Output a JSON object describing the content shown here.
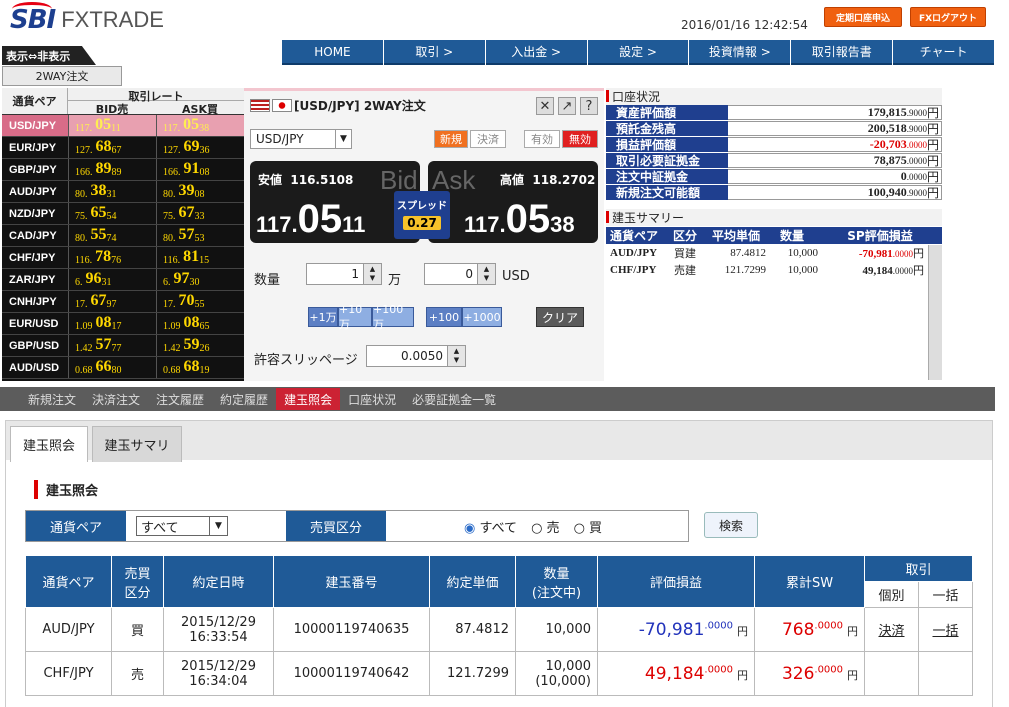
{
  "header": {
    "logo_main": "SBI",
    "logo_sub": "FXTRADE",
    "datetime": "2016/01/16 12:42:54",
    "btn_periodic": "定期口座申込",
    "btn_logout": "FXログアウト"
  },
  "nav": [
    "HOME",
    "取引 >",
    "入出金 >",
    "設定 >",
    "投資情報 >",
    "取引報告書",
    "チャート"
  ],
  "toggle_label": "表示⇔非表示",
  "way_tab": "2WAY注文",
  "rates": {
    "hdr_pair": "通貨ペア",
    "hdr_rate": "取引レート",
    "hdr_bid": "BID売",
    "hdr_ask": "ASK買",
    "rows": [
      {
        "pair": "USD/JPY",
        "bid": [
          "117.",
          "05",
          "11"
        ],
        "ask": [
          "117.",
          "05",
          "38"
        ]
      },
      {
        "pair": "EUR/JPY",
        "bid": [
          "127.",
          "68",
          "67"
        ],
        "ask": [
          "127.",
          "69",
          "36"
        ]
      },
      {
        "pair": "GBP/JPY",
        "bid": [
          "166.",
          "89",
          "89"
        ],
        "ask": [
          "166.",
          "91",
          "08"
        ]
      },
      {
        "pair": "AUD/JPY",
        "bid": [
          "80.",
          "38",
          "31"
        ],
        "ask": [
          "80.",
          "39",
          "08"
        ]
      },
      {
        "pair": "NZD/JPY",
        "bid": [
          "75.",
          "65",
          "54"
        ],
        "ask": [
          "75.",
          "67",
          "33"
        ]
      },
      {
        "pair": "CAD/JPY",
        "bid": [
          "80.",
          "55",
          "74"
        ],
        "ask": [
          "80.",
          "57",
          "53"
        ]
      },
      {
        "pair": "CHF/JPY",
        "bid": [
          "116.",
          "78",
          "76"
        ],
        "ask": [
          "116.",
          "81",
          "15"
        ]
      },
      {
        "pair": "ZAR/JPY",
        "bid": [
          "6.",
          "96",
          "31"
        ],
        "ask": [
          "6.",
          "97",
          "30"
        ]
      },
      {
        "pair": "CNH/JPY",
        "bid": [
          "17.",
          "67",
          "97"
        ],
        "ask": [
          "17.",
          "70",
          "55"
        ]
      },
      {
        "pair": "EUR/USD",
        "bid": [
          "1.09",
          "08",
          "17"
        ],
        "ask": [
          "1.09",
          "08",
          "65"
        ]
      },
      {
        "pair": "GBP/USD",
        "bid": [
          "1.42",
          "57",
          "77"
        ],
        "ask": [
          "1.42",
          "59",
          "26"
        ]
      },
      {
        "pair": "AUD/USD",
        "bid": [
          "0.68",
          "66",
          "80"
        ],
        "ask": [
          "0.68",
          "68",
          "19"
        ]
      }
    ]
  },
  "order": {
    "title": "[USD/JPY] 2WAY注文",
    "pair_select": "USD/JPY",
    "btn_new": "新規",
    "btn_settle": "決済",
    "btn_valid": "有効",
    "btn_invalid": "無効",
    "low_label": "安値",
    "low_value": "116.5108",
    "high_label": "高値",
    "high_value": "118.2702",
    "bid_word": "Bid",
    "ask_word": "Ask",
    "bid_big_a": "117.",
    "bid_big_b": "05",
    "bid_big_c": "11",
    "ask_big_a": "117.",
    "ask_big_b": "05",
    "ask_big_c": "38",
    "spread_label": "スプレッド",
    "spread_value": "0.27",
    "qty_label": "数量",
    "qty_value": "1",
    "qty_unit": "万",
    "usd_value": "0",
    "usd_unit": "USD",
    "quick_btns": [
      "+1万",
      "+10万",
      "+100万"
    ],
    "quick_btns2": [
      "+100",
      "+1000"
    ],
    "clear_label": "クリア",
    "slip_label": "許容スリッページ",
    "slip_value": "0.0050"
  },
  "account": {
    "section_title": "口座状況",
    "rows": [
      {
        "label": "資産評価額",
        "value": "179,815",
        "dec": ".9000",
        "unit": "円",
        "neg": false
      },
      {
        "label": "預託金残高",
        "value": "200,518",
        "dec": ".9000",
        "unit": "円",
        "neg": false
      },
      {
        "label": "損益評価額",
        "value": "-20,703",
        "dec": ".0000",
        "unit": "円",
        "neg": true
      },
      {
        "label": "取引必要証拠金",
        "value": "78,875",
        "dec": ".0000",
        "unit": "円",
        "neg": false
      },
      {
        "label": "注文中証拠金",
        "value": "0",
        "dec": ".0000",
        "unit": "円",
        "neg": false
      },
      {
        "label": "新規注文可能額",
        "value": "100,940",
        "dec": ".9000",
        "unit": "円",
        "neg": false
      }
    ],
    "summary_title": "建玉サマリー",
    "sum_headers": [
      "通貨ペア",
      "区分",
      "平均単価",
      "数量",
      "SP評価損益"
    ],
    "sum_rows": [
      {
        "pair": "AUD/JPY",
        "side": "買建",
        "avg": "87.4812",
        "qty": "10,000",
        "pl": "-70,981",
        "dec": ".0000",
        "unit": "円",
        "neg": true
      },
      {
        "pair": "CHF/JPY",
        "side": "売建",
        "avg": "121.7299",
        "qty": "10,000",
        "pl": "49,184",
        "dec": ".0000",
        "unit": "円",
        "neg": false
      }
    ]
  },
  "tabs": [
    "新規注文",
    "決済注文",
    "注文履歴",
    "約定履歴",
    "建玉照会",
    "口座状況",
    "必要証拠金一覧"
  ],
  "subtabs": [
    "建玉照会",
    "建玉サマリ"
  ],
  "section_heading": "建玉照会",
  "filter": {
    "pair_label": "通貨ペア",
    "pair_value": "すべて",
    "side_label": "売買区分",
    "opt_all": "すべて",
    "opt_sell": "売",
    "opt_buy": "買",
    "search_label": "検索"
  },
  "positions": {
    "headers": [
      "通貨ペア",
      "売買\n区分",
      "約定日時",
      "建玉番号",
      "約定単価",
      "数量\n(注文中)",
      "評価損益",
      "累計SW",
      "取引"
    ],
    "sub_headers": [
      "個別",
      "一括"
    ],
    "rows": [
      {
        "pair": "AUD/JPY",
        "side": "買",
        "date": "2015/12/29",
        "time": "16:33:54",
        "id": "10000119740635",
        "price": "87.4812",
        "qty": "10,000",
        "qty_pending": "",
        "pl": "-70,981",
        "pl_dec": ".0000",
        "sw": "768",
        "sw_dec": ".0000",
        "unit": "円",
        "btn_settle": "決済",
        "btn_bulk": "一括"
      },
      {
        "pair": "CHF/JPY",
        "side": "売",
        "date": "2015/12/29",
        "time": "16:34:04",
        "id": "10000119740642",
        "price": "121.7299",
        "qty": "10,000",
        "qty_pending": "(10,000)",
        "pl": "49,184",
        "pl_dec": ".0000",
        "sw": "326",
        "sw_dec": ".0000",
        "unit": "円",
        "btn_settle": "",
        "btn_bulk": ""
      }
    ]
  }
}
